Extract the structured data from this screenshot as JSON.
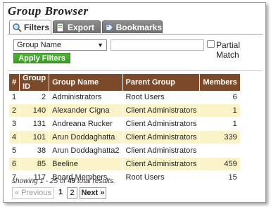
{
  "app": {
    "title": "Group Browser"
  },
  "tabs": [
    {
      "label": "Filters",
      "icon": "magnifier-icon",
      "active": true
    },
    {
      "label": "Export",
      "icon": "export-document-icon",
      "active": false
    },
    {
      "label": "Bookmarks",
      "icon": "bookmark-tag-icon",
      "active": false
    }
  ],
  "filters": {
    "field_select_value": "Group Name",
    "search_value": "",
    "partial_match_label": "Partial Match",
    "partial_match_checked": false,
    "apply_label": "Apply Filters"
  },
  "table": {
    "headers": [
      "#",
      "Group ID",
      "Group Name",
      "Parent Group",
      "Members"
    ],
    "rows": [
      {
        "n": "1",
        "id": "2",
        "name": "Administrators",
        "parent": "Root Users",
        "members": "6"
      },
      {
        "n": "2",
        "id": "140",
        "name": "Alexander Cigna",
        "parent": "Client Administrators",
        "members": "1"
      },
      {
        "n": "3",
        "id": "131",
        "name": "Andreana Rucker",
        "parent": "Client Administrators",
        "members": "1"
      },
      {
        "n": "4",
        "id": "101",
        "name": "Arun Doddaghatta",
        "parent": "Client Administrators",
        "members": "339"
      },
      {
        "n": "5",
        "id": "38",
        "name": "Arun Doddaghatta2",
        "parent": "Client Administrators",
        "members": ""
      },
      {
        "n": "6",
        "id": "85",
        "name": "Beeline",
        "parent": "Client Administrators",
        "members": "459"
      },
      {
        "n": "7",
        "id": "117",
        "name": "Board Members",
        "parent": "Root Users",
        "members": "15"
      }
    ]
  },
  "summary": {
    "prefix": "showing 1 - 25 of",
    "total": "49",
    "suffix": "total results."
  },
  "pager": {
    "prev_label": "« Previous",
    "pages": [
      "1",
      "2"
    ],
    "current_page": "1",
    "next_label": "Next »"
  },
  "colors": {
    "header_bg": "#7a4a2a",
    "stripe": "#fbf3c8",
    "apply_green": "#3d9a28",
    "link": "#1a4fb5",
    "tab_gray": "#7a7a7a"
  }
}
